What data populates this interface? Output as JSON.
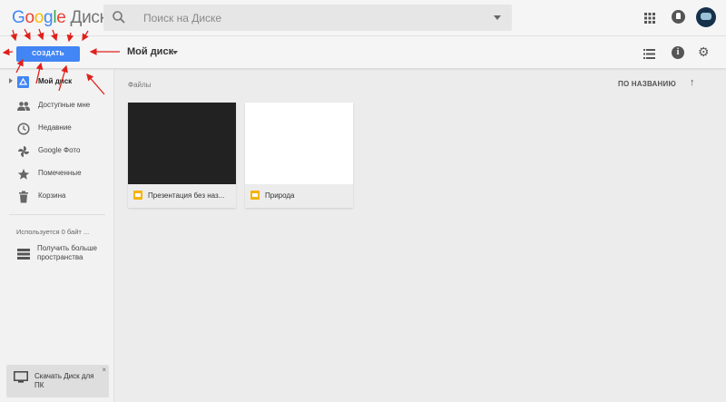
{
  "header": {
    "logo_letters": [
      "G",
      "o",
      "o",
      "g",
      "l",
      "e"
    ],
    "product": "Диск",
    "search_placeholder": "Поиск на Диске"
  },
  "toolbar": {
    "create_label": "СОЗДАТЬ",
    "title": "Мой диск"
  },
  "sidebar": {
    "items": [
      {
        "label": "Мой диск",
        "icon": "drive-icon",
        "active": true
      },
      {
        "label": "Доступные мне",
        "icon": "people-icon"
      },
      {
        "label": "Недавние",
        "icon": "clock-icon"
      },
      {
        "label": "Google Фото",
        "icon": "photos-icon"
      },
      {
        "label": "Помеченные",
        "icon": "star-icon"
      },
      {
        "label": "Корзина",
        "icon": "trash-icon"
      }
    ],
    "usage": "Используется 0 байт ...",
    "more_space": "Получить больше пространства",
    "download_banner": "Скачать Диск для ПК",
    "download_close": "×"
  },
  "main": {
    "section_label": "Файлы",
    "sort_label": "ПО НАЗВАНИЮ",
    "sort_arrow": "↑",
    "files": [
      {
        "name": "Презентация без наз...",
        "thumb_color": "#222222",
        "icon": "slides-icon"
      },
      {
        "name": "Природа",
        "thumb_color": "#ffffff",
        "icon": "slides-icon"
      }
    ]
  },
  "colors": {
    "accent": "#4285f4",
    "annotation": "#e0201b",
    "slides": "#f4b400"
  }
}
